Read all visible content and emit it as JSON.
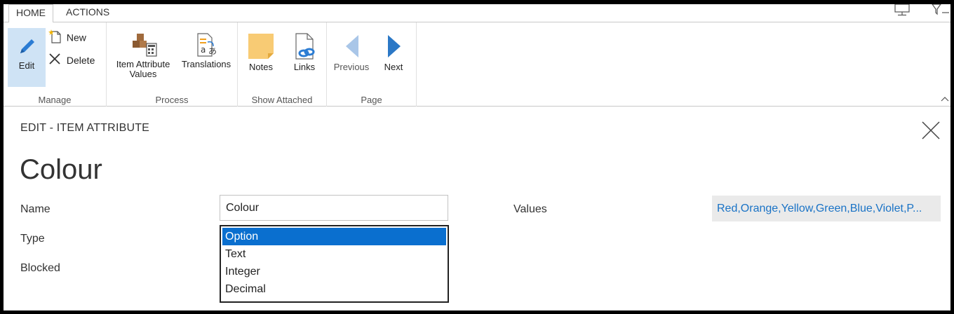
{
  "tabs": [
    {
      "label": "HOME"
    },
    {
      "label": "ACTIONS"
    }
  ],
  "ribbon": {
    "manage": {
      "group_label": "Manage",
      "edit": "Edit",
      "new": "New",
      "delete": "Delete"
    },
    "process": {
      "group_label": "Process",
      "item_attribute_values_line1": "Item Attribute",
      "item_attribute_values_line2": "Values",
      "translations": "Translations"
    },
    "show_attached": {
      "group_label": "Show Attached",
      "notes": "Notes",
      "links": "Links"
    },
    "page": {
      "group_label": "Page",
      "previous": "Previous",
      "next": "Next"
    }
  },
  "page": {
    "caption": "EDIT - ITEM ATTRIBUTE",
    "title": "Colour"
  },
  "form": {
    "name_label": "Name",
    "name_value": "Colour",
    "type_label": "Type",
    "blocked_label": "Blocked",
    "values_label": "Values",
    "values_value": "Red,Orange,Yellow,Green,Blue,Violet,P...",
    "type_options": [
      "Option",
      "Text",
      "Integer",
      "Decimal"
    ],
    "type_selected": "Option"
  },
  "colors": {
    "accent_blue": "#0a6fcf",
    "link_blue": "#1a73c6",
    "selected_ribbon": "#cfe3f5"
  }
}
